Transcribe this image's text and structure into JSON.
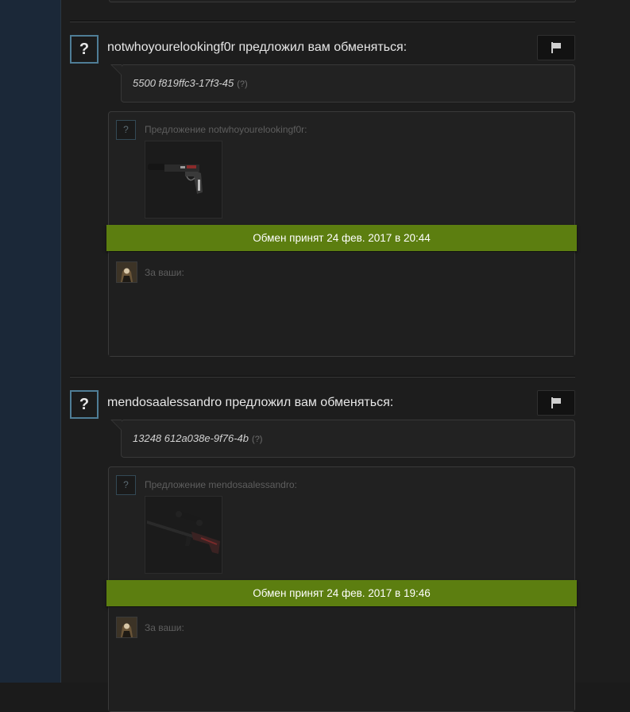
{
  "offers": [
    {
      "partner_icon": "?",
      "title": "notwhoyourelookingf0r предложил вам обменяться:",
      "message": "5500 f819ffc3-17f3-45",
      "message_help": "(?)",
      "offer_icon": "?",
      "offer_label": "Предложение notwhoyourelookingf0r:",
      "item_icon": "pistol-item-icon",
      "status": "Обмен принят 24 фев. 2017 в 20:44",
      "for_yours_label": "За ваши:"
    },
    {
      "partner_icon": "?",
      "title": "mendosaalessandro предложил вам обменяться:",
      "message": "13248 612a038e-9f76-4b",
      "message_help": "(?)",
      "offer_icon": "?",
      "offer_label": "Предложение mendosaalessandro:",
      "item_icon": "sniper-rifle-item-icon",
      "status": "Обмен принят 24 фев. 2017 в 19:46",
      "for_yours_label": "За ваши:"
    }
  ],
  "colors": {
    "accepted_banner": "#5c7e10",
    "avatar_border": "#4f7d96",
    "left_rail": "#1b2838"
  }
}
